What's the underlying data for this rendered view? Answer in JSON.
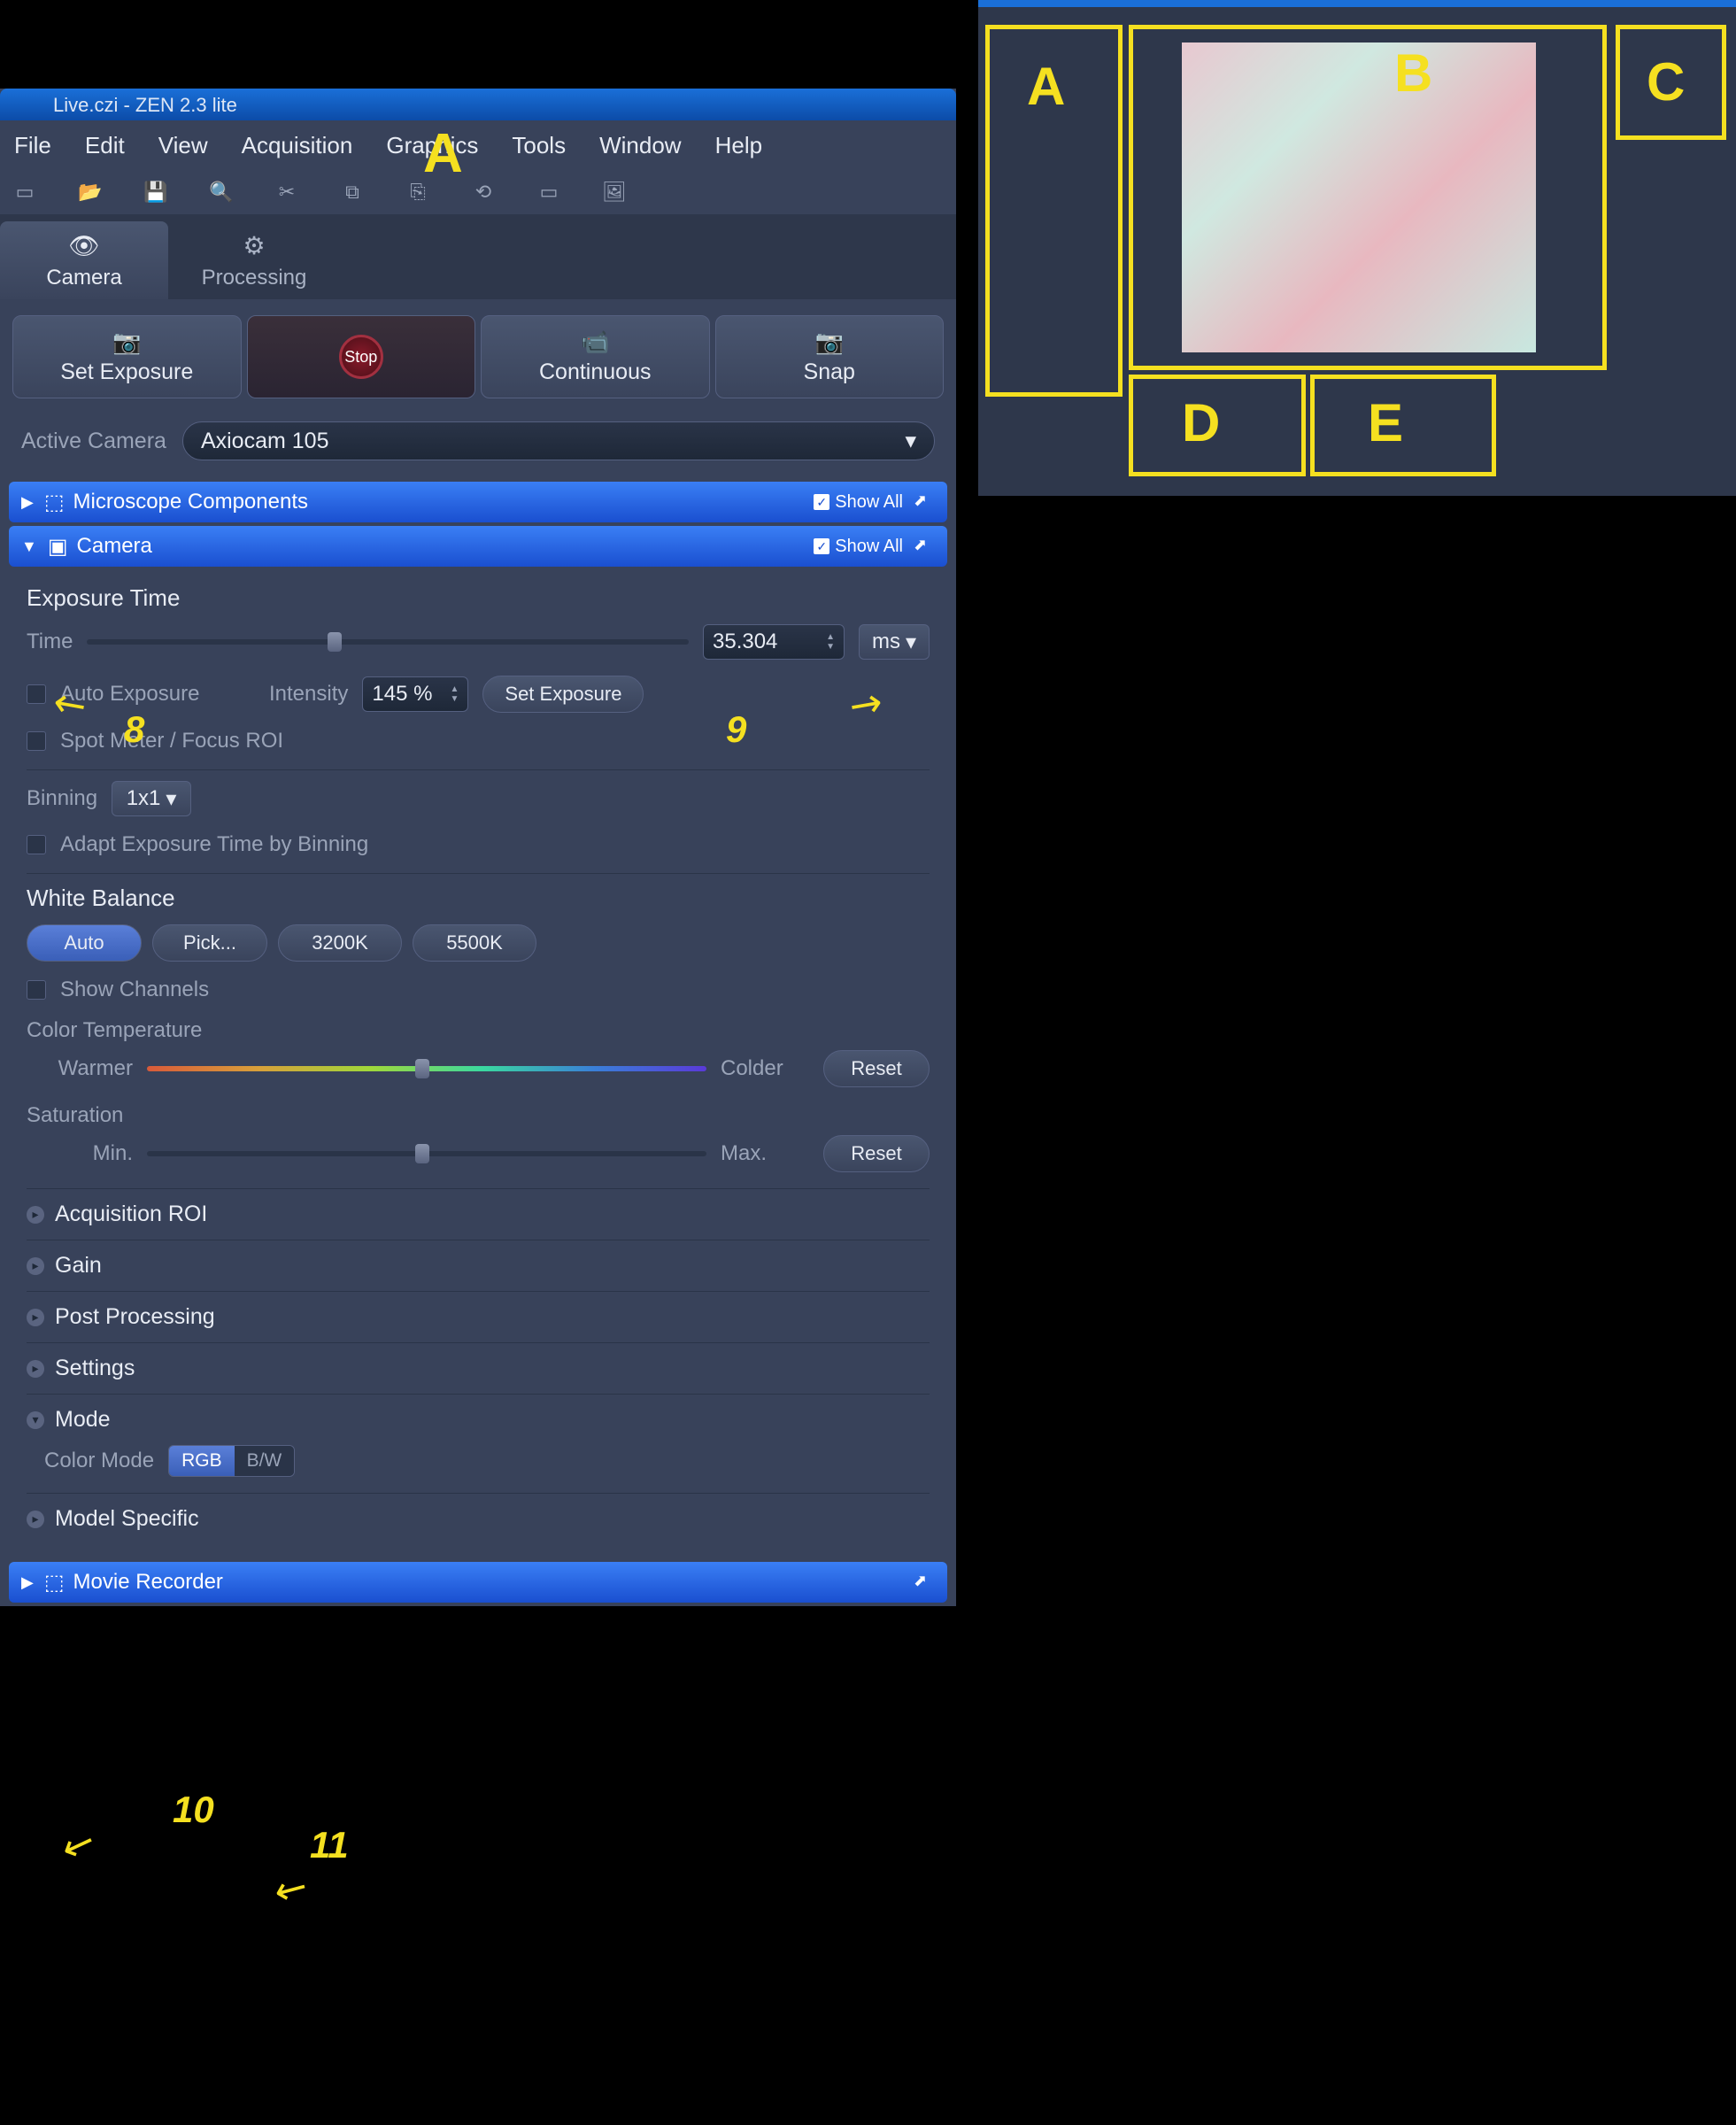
{
  "titlebar": "Live.czi - ZEN 2.3 lite",
  "menu": {
    "file": "File",
    "edit": "Edit",
    "view": "View",
    "acq": "Acquisition",
    "gfx": "Graphics",
    "tools": "Tools",
    "window": "Window",
    "help": "Help"
  },
  "maintabs": {
    "camera": "Camera",
    "processing": "Processing"
  },
  "acq": {
    "setexp": "Set Exposure",
    "stop": "Stop",
    "cont": "Continuous",
    "snap": "Snap"
  },
  "activecam": {
    "label": "Active Camera",
    "value": "Axiocam 105"
  },
  "sections": {
    "micro": "Microscope Components",
    "camera": "Camera",
    "movie": "Movie Recorder",
    "showall": "Show All"
  },
  "exposure": {
    "title": "Exposure Time",
    "time_lbl": "Time",
    "time_val": "35.304",
    "time_unit": "ms",
    "auto": "Auto Exposure",
    "intensity_lbl": "Intensity",
    "intensity_val": "145 %",
    "setexp": "Set Exposure",
    "spot": "Spot Meter / Focus ROI"
  },
  "binning": {
    "label": "Binning",
    "value": "1x1",
    "adapt": "Adapt Exposure Time by Binning"
  },
  "wb": {
    "title": "White Balance",
    "auto": "Auto",
    "pick": "Pick...",
    "k3200": "3200K",
    "k5500": "5500K",
    "showch": "Show Channels",
    "ct_title": "Color Temperature",
    "warmer": "Warmer",
    "colder": "Colder",
    "sat_title": "Saturation",
    "min": "Min.",
    "max": "Max.",
    "reset": "Reset"
  },
  "subs": {
    "acqroi": "Acquisition ROI",
    "gain": "Gain",
    "post": "Post Processing",
    "settings": "Settings",
    "mode": "Mode",
    "modelspec": "Model Specific"
  },
  "colormode": {
    "label": "Color Mode",
    "rgb": "RGB",
    "bw": "B/W"
  },
  "annot": {
    "A": "A",
    "B": "B",
    "C": "C",
    "D": "D",
    "E": "E",
    "n8": "8",
    "n9": "9",
    "n10": "10",
    "n11": "11"
  }
}
